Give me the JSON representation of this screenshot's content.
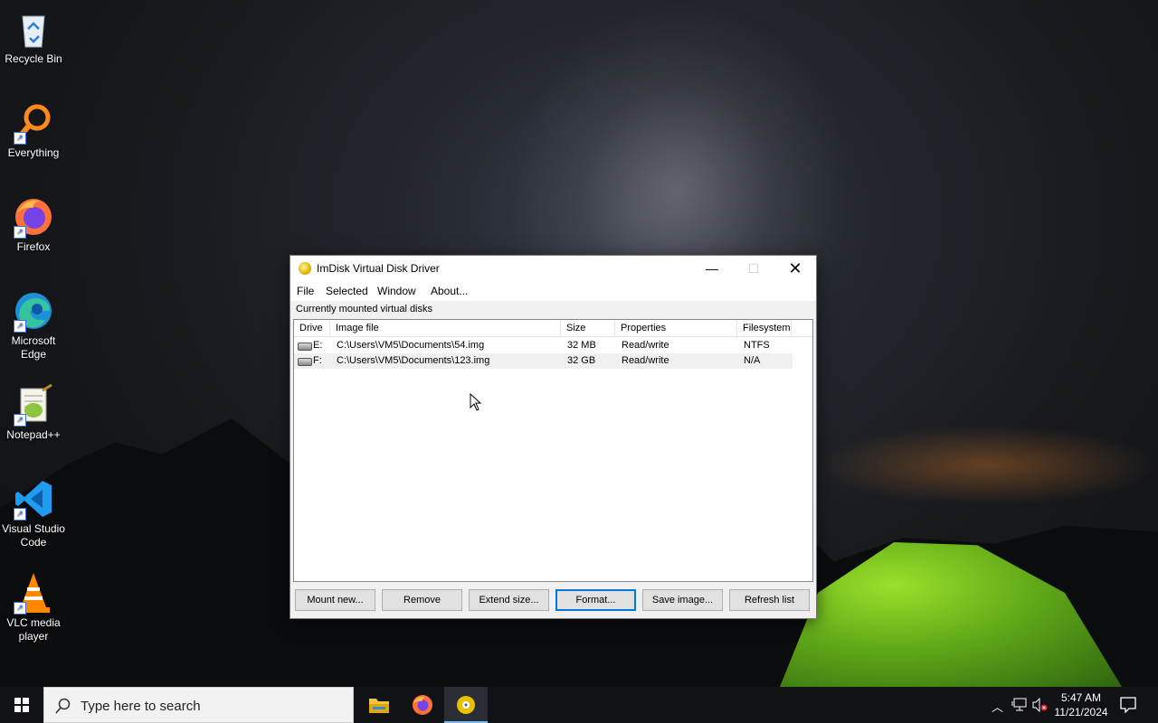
{
  "desktop": {
    "icons": [
      {
        "label": "Recycle Bin"
      },
      {
        "label": "Everything"
      },
      {
        "label": "Firefox"
      },
      {
        "label": "Microsoft Edge"
      },
      {
        "label": "Notepad++"
      },
      {
        "label": "Visual Studio Code"
      },
      {
        "label": "VLC media player"
      }
    ]
  },
  "window": {
    "title": "ImDisk Virtual Disk Driver",
    "controls": {
      "minimize": "—",
      "maximize": "☐",
      "close": "✕"
    },
    "menu": [
      "File",
      "Selected",
      "Window",
      "About..."
    ],
    "caption": "Currently mounted virtual disks",
    "columns": [
      "Drive",
      "Image file",
      "Size",
      "Properties",
      "Filesystem"
    ],
    "rows": [
      {
        "drive": "E:",
        "image": "C:\\Users\\VM5\\Documents\\54.img",
        "size": "32 MB",
        "properties": "Read/write",
        "filesystem": "NTFS"
      },
      {
        "drive": "F:",
        "image": "C:\\Users\\VM5\\Documents\\123.img",
        "size": "32 GB",
        "properties": "Read/write",
        "filesystem": "N/A"
      }
    ],
    "buttons": [
      "Mount new...",
      "Remove",
      "Extend size...",
      "Format...",
      "Save image...",
      "Refresh list"
    ]
  },
  "taskbar": {
    "search_placeholder": "Type here to search",
    "time": "5:47 AM",
    "date": "11/21/2024",
    "apps": [
      "file-explorer-icon",
      "firefox-icon",
      "imdisk-icon"
    ]
  },
  "colors": {
    "accent": "#0078d7",
    "taskbar": "#101215",
    "tent": "#7cc520"
  }
}
